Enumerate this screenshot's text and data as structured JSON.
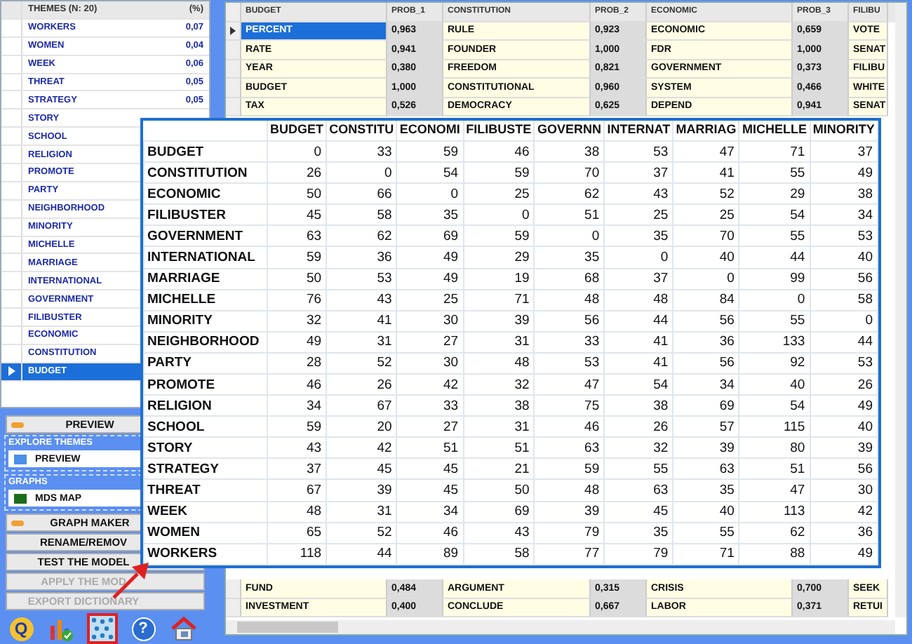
{
  "themes": {
    "columns": [
      "THEMES (N: 20)",
      "(%)"
    ],
    "rows": [
      {
        "name": "WORKERS",
        "pct": "0,07",
        "selected": false
      },
      {
        "name": "WOMEN",
        "pct": "0,04",
        "selected": false
      },
      {
        "name": "WEEK",
        "pct": "0,06",
        "selected": false
      },
      {
        "name": "THREAT",
        "pct": "0,05",
        "selected": false
      },
      {
        "name": "STRATEGY",
        "pct": "0,05",
        "selected": false
      },
      {
        "name": "STORY",
        "selected": false
      },
      {
        "name": "SCHOOL",
        "selected": false
      },
      {
        "name": "RELIGION",
        "selected": false
      },
      {
        "name": "PROMOTE",
        "selected": false
      },
      {
        "name": "PARTY",
        "selected": false
      },
      {
        "name": "NEIGHBORHOOD",
        "selected": false
      },
      {
        "name": "MINORITY",
        "selected": false
      },
      {
        "name": "MICHELLE",
        "selected": false
      },
      {
        "name": "MARRIAGE",
        "selected": false
      },
      {
        "name": "INTERNATIONAL",
        "selected": false
      },
      {
        "name": "GOVERNMENT",
        "selected": false
      },
      {
        "name": "FILIBUSTER",
        "selected": false
      },
      {
        "name": "ECONOMIC",
        "selected": false
      },
      {
        "name": "CONSTITUTION",
        "selected": false
      },
      {
        "name": "BUDGET",
        "selected": true
      }
    ]
  },
  "preview_button": "PREVIEW",
  "groups": [
    {
      "label": "EXPLORE THEMES",
      "item": "PREVIEW",
      "kind": "preview"
    },
    {
      "label": "GRAPHS",
      "item": "MDS MAP",
      "kind": "map"
    }
  ],
  "buttons": [
    {
      "label": "GRAPH MAKER",
      "kind": "toggle",
      "disabled": false
    },
    {
      "label": "RENAME/REMOV",
      "kind": "plain",
      "disabled": false
    },
    {
      "label": "TEST THE MODEL",
      "kind": "plain",
      "disabled": false
    },
    {
      "label": "APPLY THE MOD",
      "kind": "plain",
      "disabled": true
    },
    {
      "label": "EXPORT DICTIONARY",
      "kind": "plain",
      "disabled": true
    }
  ],
  "toolbar": [
    {
      "kind": "logo",
      "text": "Q",
      "selected": false
    },
    {
      "kind": "chart",
      "selected": false
    },
    {
      "kind": "grid",
      "selected": true
    },
    {
      "kind": "help",
      "text": "?",
      "selected": false
    },
    {
      "kind": "home",
      "selected": false
    }
  ],
  "grid": {
    "columns": [
      "BUDGET",
      "PROB_1",
      "CONSTITUTION",
      "PROB_2",
      "ECONOMIC",
      "PROB_3",
      "FILIBU"
    ],
    "top_rows": [
      {
        "cells": [
          "PERCENT",
          "0,963",
          "RULE",
          "0,923",
          "ECONOMIC",
          "0,659",
          "VOTE"
        ],
        "current": true,
        "selected": true
      },
      {
        "cells": [
          "RATE",
          "0,941",
          "FOUNDER",
          "1,000",
          "FDR",
          "1,000",
          "SENAT"
        ],
        "current": false,
        "selected": false
      },
      {
        "cells": [
          "YEAR",
          "0,380",
          "FREEDOM",
          "0,821",
          "GOVERNMENT",
          "0,373",
          "FILIBU"
        ],
        "current": false,
        "selected": false
      },
      {
        "cells": [
          "BUDGET",
          "1,000",
          "CONSTITUTIONAL",
          "0,960",
          "SYSTEM",
          "0,466",
          "WHITE"
        ],
        "current": false,
        "selected": false
      },
      {
        "cells": [
          "TAX",
          "0,526",
          "DEMOCRACY",
          "0,625",
          "DEPEND",
          "0,941",
          "SENAT"
        ],
        "current": false,
        "selected": false
      }
    ],
    "bottom_rows": [
      {
        "cells": [
          "FUND",
          "0,484",
          "ARGUMENT",
          "0,315",
          "CRISIS",
          "0,700",
          "SEEK"
        ],
        "current": false,
        "selected": false
      },
      {
        "cells": [
          "INVESTMENT",
          "0,400",
          "CONCLUDE",
          "0,667",
          "LABOR",
          "0,371",
          "RETUI"
        ],
        "current": false,
        "selected": false
      }
    ]
  },
  "matrix": {
    "columns": [
      "BUDGET",
      "CONSTITU",
      "ECONOMI",
      "FILIBUSTE",
      "GOVERNN",
      "INTERNAT",
      "MARRIAG",
      "MICHELLE",
      "MINORITY"
    ],
    "rows": [
      {
        "label": "BUDGET",
        "values": [
          "0",
          "33",
          "59",
          "46",
          "38",
          "53",
          "47",
          "71",
          "37"
        ]
      },
      {
        "label": "CONSTITUTION",
        "values": [
          "26",
          "0",
          "54",
          "59",
          "70",
          "37",
          "41",
          "55",
          "49"
        ]
      },
      {
        "label": "ECONOMIC",
        "values": [
          "50",
          "66",
          "0",
          "25",
          "62",
          "43",
          "52",
          "29",
          "38"
        ]
      },
      {
        "label": "FILIBUSTER",
        "values": [
          "45",
          "58",
          "35",
          "0",
          "51",
          "25",
          "25",
          "54",
          "34"
        ]
      },
      {
        "label": "GOVERNMENT",
        "values": [
          "63",
          "62",
          "69",
          "59",
          "0",
          "35",
          "70",
          "55",
          "53"
        ]
      },
      {
        "label": "INTERNATIONAL",
        "values": [
          "59",
          "36",
          "49",
          "29",
          "35",
          "0",
          "40",
          "44",
          "40"
        ]
      },
      {
        "label": "MARRIAGE",
        "values": [
          "50",
          "53",
          "49",
          "19",
          "68",
          "37",
          "0",
          "99",
          "56"
        ]
      },
      {
        "label": "MICHELLE",
        "values": [
          "76",
          "43",
          "25",
          "71",
          "48",
          "48",
          "84",
          "0",
          "58"
        ]
      },
      {
        "label": "MINORITY",
        "values": [
          "32",
          "41",
          "30",
          "39",
          "56",
          "44",
          "56",
          "55",
          "0"
        ]
      },
      {
        "label": "NEIGHBORHOOD",
        "values": [
          "49",
          "31",
          "27",
          "31",
          "33",
          "41",
          "36",
          "133",
          "44"
        ]
      },
      {
        "label": "PARTY",
        "values": [
          "28",
          "52",
          "30",
          "48",
          "53",
          "41",
          "56",
          "92",
          "53"
        ]
      },
      {
        "label": "PROMOTE",
        "values": [
          "46",
          "26",
          "42",
          "32",
          "47",
          "54",
          "34",
          "40",
          "26"
        ]
      },
      {
        "label": "RELIGION",
        "values": [
          "34",
          "67",
          "33",
          "38",
          "75",
          "38",
          "69",
          "54",
          "49"
        ]
      },
      {
        "label": "SCHOOL",
        "values": [
          "59",
          "20",
          "27",
          "31",
          "46",
          "26",
          "57",
          "115",
          "40"
        ]
      },
      {
        "label": "STORY",
        "values": [
          "43",
          "42",
          "51",
          "51",
          "63",
          "32",
          "39",
          "80",
          "39"
        ]
      },
      {
        "label": "STRATEGY",
        "values": [
          "37",
          "45",
          "45",
          "21",
          "59",
          "55",
          "63",
          "51",
          "56"
        ]
      },
      {
        "label": "THREAT",
        "values": [
          "67",
          "39",
          "45",
          "50",
          "48",
          "63",
          "35",
          "47",
          "30"
        ]
      },
      {
        "label": "WEEK",
        "values": [
          "48",
          "31",
          "34",
          "69",
          "39",
          "45",
          "40",
          "113",
          "42"
        ]
      },
      {
        "label": "WOMEN",
        "values": [
          "65",
          "52",
          "46",
          "43",
          "79",
          "35",
          "55",
          "62",
          "36"
        ]
      },
      {
        "label": "WORKERS",
        "values": [
          "118",
          "44",
          "89",
          "58",
          "77",
          "79",
          "71",
          "88",
          "49"
        ]
      }
    ]
  }
}
